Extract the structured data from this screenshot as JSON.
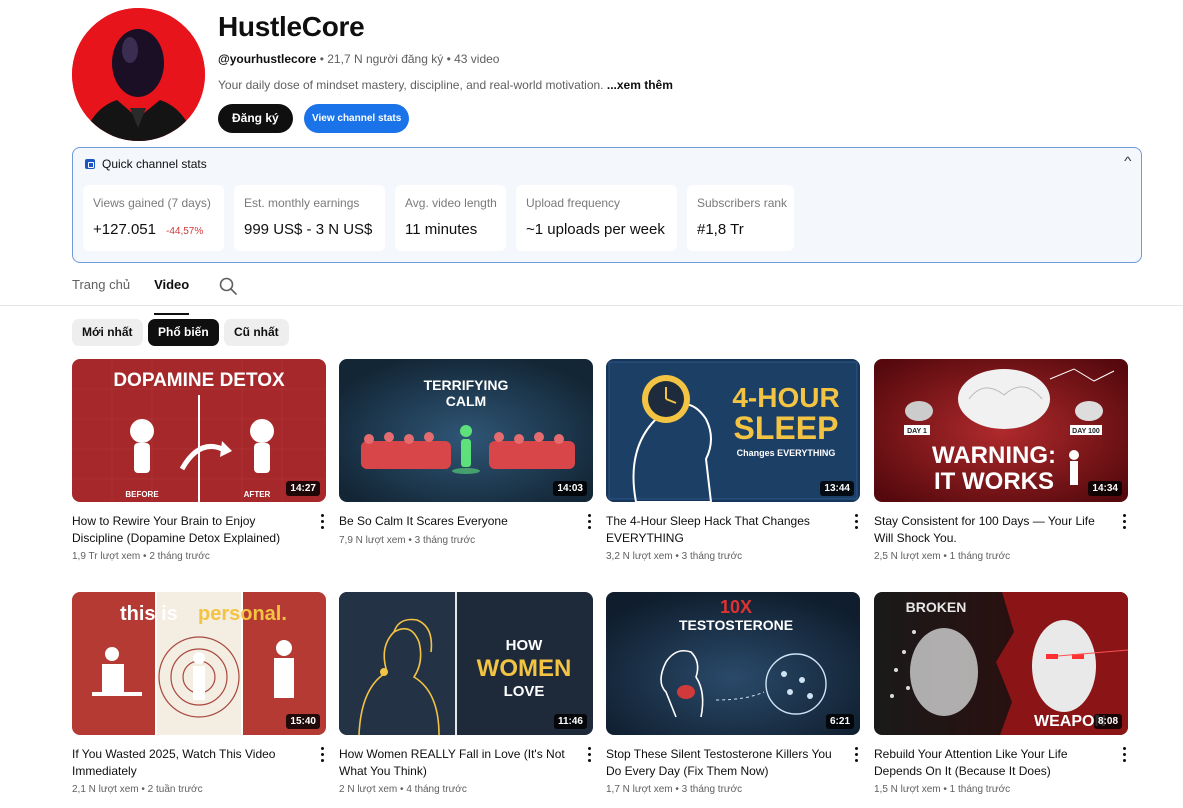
{
  "channel": {
    "name": "HustleCore",
    "handle": "@yourhustlecore",
    "meta": " • 21,7 N người đăng ký • 43 video",
    "description": "Your daily dose of mindset mastery, discipline, and real-world motivation. ",
    "more_label": "...xem thêm",
    "subscribe_label": "Đăng ký",
    "stats_button_label": "View channel stats"
  },
  "stats_panel": {
    "title": "Quick channel stats",
    "cards": [
      {
        "label": "Views gained (7 days)",
        "value": "+127.051",
        "delta": "-44,57%"
      },
      {
        "label": "Est. monthly earnings",
        "value": "999 US$ - 3 N US$"
      },
      {
        "label": "Avg. video length",
        "value": "11 minutes"
      },
      {
        "label": "Upload frequency",
        "value": "~1 uploads per week"
      },
      {
        "label": "Subscribers rank",
        "value": "#1,8 Tr"
      }
    ]
  },
  "tabs": [
    {
      "label": "Trang chủ"
    },
    {
      "label": "Video"
    }
  ],
  "chips": [
    {
      "label": "Mới nhất"
    },
    {
      "label": "Phổ biến"
    },
    {
      "label": "Cũ nhất"
    }
  ],
  "videos": [
    {
      "title": "How to Rewire Your Brain to Enjoy Discipline (Dopamine Detox Explained)",
      "meta": "1,9 Tr lượt xem • 2 tháng trước",
      "duration": "14:27",
      "thumb_text": [
        "DOPAMINE DETOX",
        "BEFORE",
        "AFTER"
      ]
    },
    {
      "title": "Be So Calm It Scares Everyone",
      "meta": "7,9 N lượt xem • 3 tháng trước",
      "duration": "14:03",
      "thumb_text": [
        "TERRIFYING",
        "CALM"
      ]
    },
    {
      "title": "The 4-Hour Sleep Hack That Changes EVERYTHING",
      "meta": "3,2 N lượt xem • 3 tháng trước",
      "duration": "13:44",
      "thumb_text": [
        "4-HOUR",
        "SLEEP",
        "Changes EVERYTHING"
      ]
    },
    {
      "title": "Stay Consistent for 100 Days — Your Life Will Shock You.",
      "meta": "2,5 N lượt xem • 1 tháng trước",
      "duration": "14:34",
      "thumb_text": [
        "WARNING:",
        "IT WORKS",
        "DAY 1",
        "DAY 100"
      ]
    },
    {
      "title": "If You Wasted 2025, Watch This Video Immediately",
      "meta": "2,1 N lượt xem • 2 tuần trước",
      "duration": "15:40",
      "thumb_text": [
        "this is ",
        "personal."
      ]
    },
    {
      "title": "How Women REALLY Fall in Love (It's Not What You Think)",
      "meta": "2 N lượt xem • 4 tháng trước",
      "duration": "11:46",
      "thumb_text": [
        "HOW",
        "WOMEN",
        "LOVE"
      ]
    },
    {
      "title": "Stop These Silent Testosterone Killers You Do Every Day (Fix Them Now)",
      "meta": "1,7 N lượt xem • 3 tháng trước",
      "duration": "6:21",
      "thumb_text": [
        "10X",
        "TESTOSTERONE"
      ]
    },
    {
      "title": "Rebuild Your Attention Like Your Life Depends On It (Because It Does)",
      "meta": "1,5 N lượt xem • 1 tháng trước",
      "duration": "8:08",
      "thumb_text": [
        "BROKEN",
        "WEAPON"
      ]
    }
  ]
}
